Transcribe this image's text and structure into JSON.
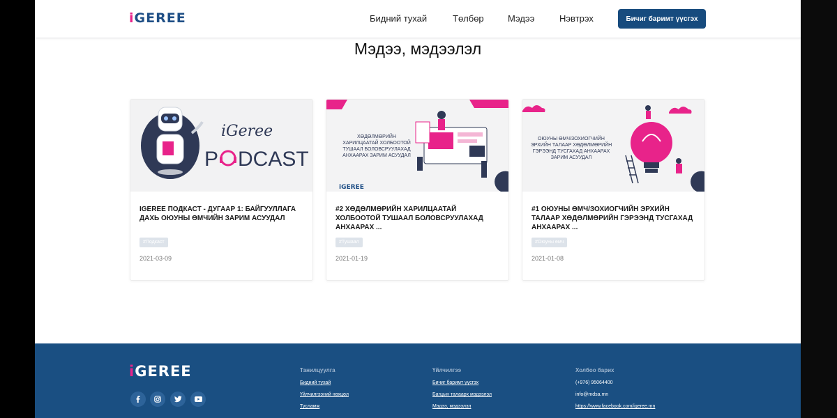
{
  "header": {
    "logo_i": "i",
    "logo_rest": "GEREE",
    "nav": [
      "Бидний тухай",
      "Төлбөр",
      "Мэдээ",
      "Нэвтрэх"
    ],
    "cta": "Бичиг баримт үүсгэх"
  },
  "main": {
    "title": "Мэдээ, мэдээлэл",
    "cards": [
      {
        "title": "IGEREE ПОДКАСТ - ДУГААР 1: БАЙГУУЛЛАГА ДАХЬ ОЮУНЫ ӨМЧИЙН ЗАРИМ АСУУДАЛ",
        "tag": "#Подкаст",
        "date": "2021-03-09",
        "image_text_1": "iGeree",
        "image_text_2": "P",
        "image_text_3": "DCAST"
      },
      {
        "title": "#2 ХӨДӨЛМӨРИЙН ХАРИЛЦААТАЙ ХОЛБООТОЙ ТУШААЛ БОЛОВСРУУЛАХАД АНХААРАХ ...",
        "tag": "#Тушаал",
        "date": "2021-01-19",
        "image_lines": [
          "ХӨДӨЛМӨРИЙН",
          "ХАРИЛЦААТАЙ ХОЛБООТОЙ",
          "ТУШААЛ БОЛОВСРУУЛАХАД",
          "АНХААРАХ ЗАРИМ АСУУДАЛ"
        ],
        "image_logo": "iGEREE"
      },
      {
        "title": "#1 ОЮУНЫ ӨМЧ/ЗОХИОГЧИЙН ЭРХИЙН ТАЛААР ХӨДӨЛМӨРИЙН ГЭРЭЭНД ТУСГАХАД АНХААРАХ ...",
        "tag": "#Оюуны өмч",
        "date": "2021-01-08",
        "image_lines": [
          "ОЮУНЫ ӨМЧ/ЗОХИОГЧИЙН",
          "ЭРХИЙН ТАЛААР ХӨДӨЛМӨРИЙН",
          "ГЭРЭЭНД ТУСГАХАД АНХААРАХ",
          "ЗАРИМ АСУУДАЛ"
        ]
      }
    ]
  },
  "footer": {
    "logo_i": "i",
    "logo_rest": "GEREE",
    "social_icons": [
      "facebook-icon",
      "instagram-icon",
      "twitter-icon",
      "youtube-icon"
    ],
    "col1": {
      "heading": "Танилцуулга",
      "links": [
        "Бидний тухай",
        "Үйлчилгээний нөхцөл",
        "Тусламж"
      ]
    },
    "col2": {
      "heading": "Үйлчилгээ",
      "links": [
        "Бичиг баримт үүсгэх",
        "Багцын талаарх мэдээлэл",
        "Мэдээ, мэдээлэл"
      ]
    },
    "col3": {
      "heading": "Холбоо барих",
      "items": [
        "(+976) 95064400",
        "info@mdsa.mn",
        "https://www.facebook.com/igeree.mn"
      ]
    }
  },
  "colors": {
    "brand_blue": "#174b7e",
    "brand_pink": "#e8238a",
    "footer_bg": "#1a4f82"
  }
}
